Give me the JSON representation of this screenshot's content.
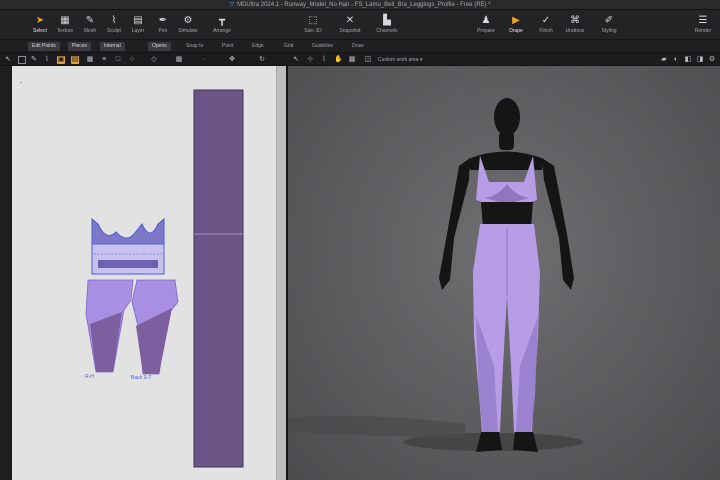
{
  "window": {
    "title": "MDUltra 2024.1 - Runway_Model_No Hair - FS_Lamu_Bell_Bra_Leggings_Profile - Free (RE) *"
  },
  "main_toolbar": {
    "left_tools": [
      {
        "label": "Select",
        "icon": "cursor-icon",
        "glyph": "➤",
        "active": true
      },
      {
        "label": "Texture",
        "icon": "grid-icon",
        "glyph": "▦"
      },
      {
        "label": "Mesh",
        "icon": "pencil-icon",
        "glyph": "✎"
      },
      {
        "label": "Sculpt",
        "icon": "brush-icon",
        "glyph": "⌇"
      },
      {
        "label": "Layer",
        "icon": "layers-icon",
        "glyph": "▤"
      },
      {
        "label": "Pen",
        "icon": "pen-icon",
        "glyph": "✒"
      },
      {
        "label": "Simulate",
        "icon": "simulate-icon",
        "glyph": "⚙"
      },
      {
        "label": "Arrange",
        "icon": "arrange-icon",
        "glyph": "┳"
      }
    ],
    "center_tools": [
      {
        "label": "Size 3D",
        "icon": "resize-icon",
        "glyph": "⬚"
      },
      {
        "label": "Snapshot",
        "icon": "snapshot-icon",
        "glyph": "✕"
      },
      {
        "label": "Channels",
        "icon": "chart-icon",
        "glyph": "▙"
      }
    ],
    "right_tools": [
      {
        "label": "Prepare",
        "icon": "prepare-icon",
        "glyph": "♟"
      },
      {
        "label": "Drape",
        "icon": "play-icon",
        "glyph": "▶",
        "active": true
      },
      {
        "label": "Finish",
        "icon": "check-icon",
        "glyph": "✓"
      },
      {
        "label": "Undress",
        "icon": "undress-icon",
        "glyph": "⌘"
      },
      {
        "label": "Styling",
        "icon": "styling-icon",
        "glyph": "✐"
      },
      {
        "label": "Render",
        "icon": "render-icon",
        "glyph": "☰"
      }
    ]
  },
  "sub_toolbar": {
    "chips": [
      "Edit Points",
      "Pieces",
      "Internal",
      "Opens"
    ],
    "options": [
      "Snap to",
      "Point",
      "Edge",
      "Grid",
      "Guideline",
      "Draw"
    ]
  },
  "icon_toolbar": {
    "view_mode": "Custom work area"
  },
  "pattern_2d": {
    "labels": {
      "left": "R-H",
      "right": "Back S-T",
      "corner": "⌐"
    },
    "colors": {
      "panel_light": "#a98fe3",
      "panel_dark": "#7d5e9e",
      "strip": "#6b5486",
      "outline": "#4b5ed8",
      "board": "#e2e2e2"
    }
  },
  "viewport_3d": {
    "colors": {
      "skin": "#151515",
      "garment": "#b79ce6",
      "garment_shade": "#8f76bd",
      "floor": "#5e5e61"
    }
  }
}
